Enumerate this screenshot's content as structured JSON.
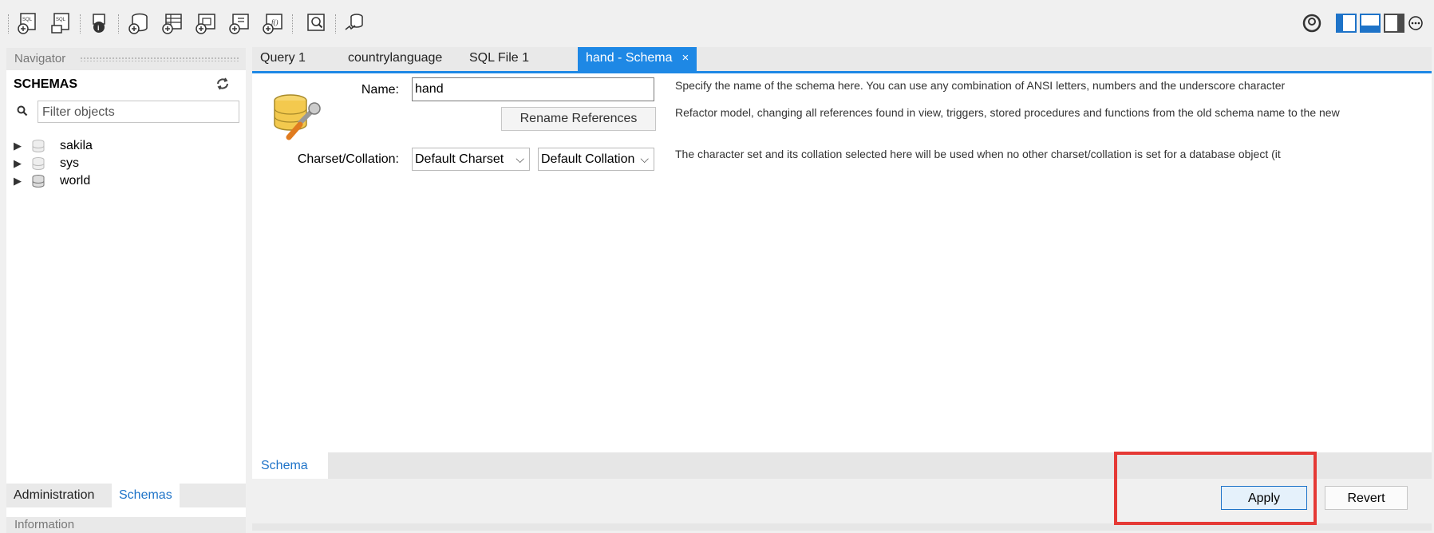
{
  "toolbar": {
    "buttons": [
      {
        "name": "new-sql-tab-icon"
      },
      {
        "name": "open-sql-script-icon"
      },
      {
        "name": "inspector-icon"
      },
      {
        "name": "create-schema-icon"
      },
      {
        "name": "create-table-icon"
      },
      {
        "name": "create-view-icon"
      },
      {
        "name": "create-procedure-icon"
      },
      {
        "name": "create-function-icon"
      },
      {
        "name": "search-table-data-icon"
      },
      {
        "name": "reconnect-icon"
      }
    ],
    "glyph_sql": "SQL"
  },
  "navigator": {
    "header": "Navigator",
    "schemas_title": "SCHEMAS",
    "filter_placeholder": "Filter objects",
    "schemas": [
      {
        "label": "sakila"
      },
      {
        "label": "sys"
      },
      {
        "label": "world"
      }
    ],
    "bottom_tabs": [
      "Administration",
      "Schemas"
    ],
    "info_header": "Information"
  },
  "tabs": [
    {
      "label": "Query 1"
    },
    {
      "label": "countrylanguage"
    },
    {
      "label": "SQL File 1"
    },
    {
      "label": "hand - Schema",
      "close": "×"
    }
  ],
  "schema_editor": {
    "name_label": "Name:",
    "name_value": "hand",
    "rename_button": "Rename References",
    "charset_label": "Charset/Collation:",
    "charset_value": "Default Charset",
    "collation_value": "Default Collation",
    "help_name": "Specify the name of the schema here. You can use any combination of ANSI letters, numbers and the underscore character",
    "help_rename": "Refactor model, changing all references found in view, triggers, stored procedures and functions from the old schema name to the new",
    "help_charset": "The character set and its collation selected here will be used when no other charset/collation is set for a database object (it",
    "subtab": "Schema",
    "apply_button": "Apply",
    "revert_button": "Revert"
  },
  "colors": {
    "accent": "#1e88e5",
    "highlight": "#e53935"
  }
}
